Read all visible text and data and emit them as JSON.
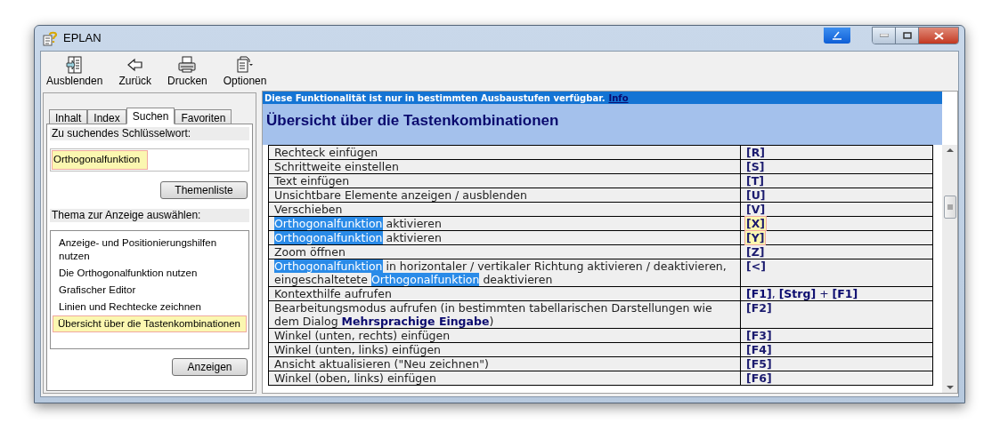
{
  "window": {
    "title": "EPLAN"
  },
  "toolbar": [
    {
      "label": "Ausblenden"
    },
    {
      "label": "Zurück"
    },
    {
      "label": "Drucken"
    },
    {
      "label": "Optionen"
    }
  ],
  "tabs": [
    {
      "label": "Inhalt",
      "selected": false
    },
    {
      "label": "Index",
      "selected": false
    },
    {
      "label": "Suchen",
      "selected": true
    },
    {
      "label": "Favoriten",
      "selected": false
    }
  ],
  "search": {
    "label": "Zu suchendes Schlüsselwort:",
    "value": "Orthogonalfunktion",
    "highlighted": true,
    "button": "Themenliste"
  },
  "topics": {
    "label": "Thema zur Anzeige auswählen:",
    "items": [
      {
        "label": "Anzeige- und Positionierungshilfen nutzen",
        "selected": false
      },
      {
        "label": "Die Orthogonalfunktion nutzen",
        "selected": false
      },
      {
        "label": "Grafischer Editor",
        "selected": false
      },
      {
        "label": "Linien und Rechtecke zeichnen",
        "selected": false
      },
      {
        "label": "Übersicht über die Tastenkombinationen",
        "selected": true
      }
    ],
    "button": "Anzeigen"
  },
  "notice": {
    "text": "Diese Funktionalität ist nur in bestimmten Ausbaustufen verfügbar.",
    "link": "Info"
  },
  "heading": "Übersicht über die Tastenkombinationen",
  "rows": [
    {
      "action": [
        {
          "text": "Rechteck einfügen"
        }
      ],
      "key": "[R]",
      "marked": false
    },
    {
      "action": [
        {
          "text": "Schrittweite einstellen"
        }
      ],
      "key": "[S]",
      "marked": false
    },
    {
      "action": [
        {
          "text": "Text einfügen"
        }
      ],
      "key": "[T]",
      "marked": false
    },
    {
      "action": [
        {
          "text": "Unsichtbare Elemente anzeigen / ausblenden"
        }
      ],
      "key": "[U]",
      "marked": false
    },
    {
      "action": [
        {
          "text": "Verschieben"
        }
      ],
      "key": "[V]",
      "marked": false
    },
    {
      "action": [
        {
          "text": "Orthogonalfunktion",
          "hit": true
        },
        {
          "text": " aktivieren"
        }
      ],
      "key": "[X]",
      "marked": true
    },
    {
      "action": [
        {
          "text": "Orthogonalfunktion",
          "hit": true
        },
        {
          "text": " aktivieren"
        }
      ],
      "key": "[Y]",
      "marked": true
    },
    {
      "action": [
        {
          "text": "Zoom öffnen"
        }
      ],
      "key": "[Z]",
      "marked": false
    },
    {
      "action": [
        {
          "text": "Orthogonalfunktion",
          "hit": true
        },
        {
          "text": " in horizontaler / vertikaler Richtung aktivieren / deaktivieren, eingeschaltetete "
        },
        {
          "text": "Orthogonalfunktion",
          "hit": true
        },
        {
          "text": " deaktivieren"
        }
      ],
      "key": "[<]",
      "marked": false
    },
    {
      "action": [
        {
          "text": "Kontexthilfe aufrufen"
        }
      ],
      "key_parts": [
        {
          "text": "[F1]",
          "bold": true
        },
        {
          "text": ", "
        },
        {
          "text": "[Strg]",
          "bold": true
        },
        {
          "text": " + "
        },
        {
          "text": "[F1]",
          "bold": true
        }
      ],
      "marked": false
    },
    {
      "action": [
        {
          "text": "Bearbeitungsmodus aufrufen (in bestimmten tabellarischen Darstellungen wie dem Dialog "
        },
        {
          "text": "Mehrsprachige Eingabe",
          "bold": true
        },
        {
          "text": ")"
        }
      ],
      "key": "[F2]",
      "marked": false
    },
    {
      "action": [
        {
          "text": "Winkel (unten, rechts) einfügen"
        }
      ],
      "key": "[F3]",
      "marked": false
    },
    {
      "action": [
        {
          "text": "Winkel (unten, links) einfügen"
        }
      ],
      "key": "[F4]",
      "marked": false
    },
    {
      "action": [
        {
          "text": "Ansicht aktualisieren (\"Neu zeichnen\")"
        }
      ],
      "key": "[F5]",
      "marked": false
    },
    {
      "action": [
        {
          "text": "Winkel (oben, links) einfügen"
        }
      ],
      "key": "[F6]",
      "marked": false
    }
  ]
}
